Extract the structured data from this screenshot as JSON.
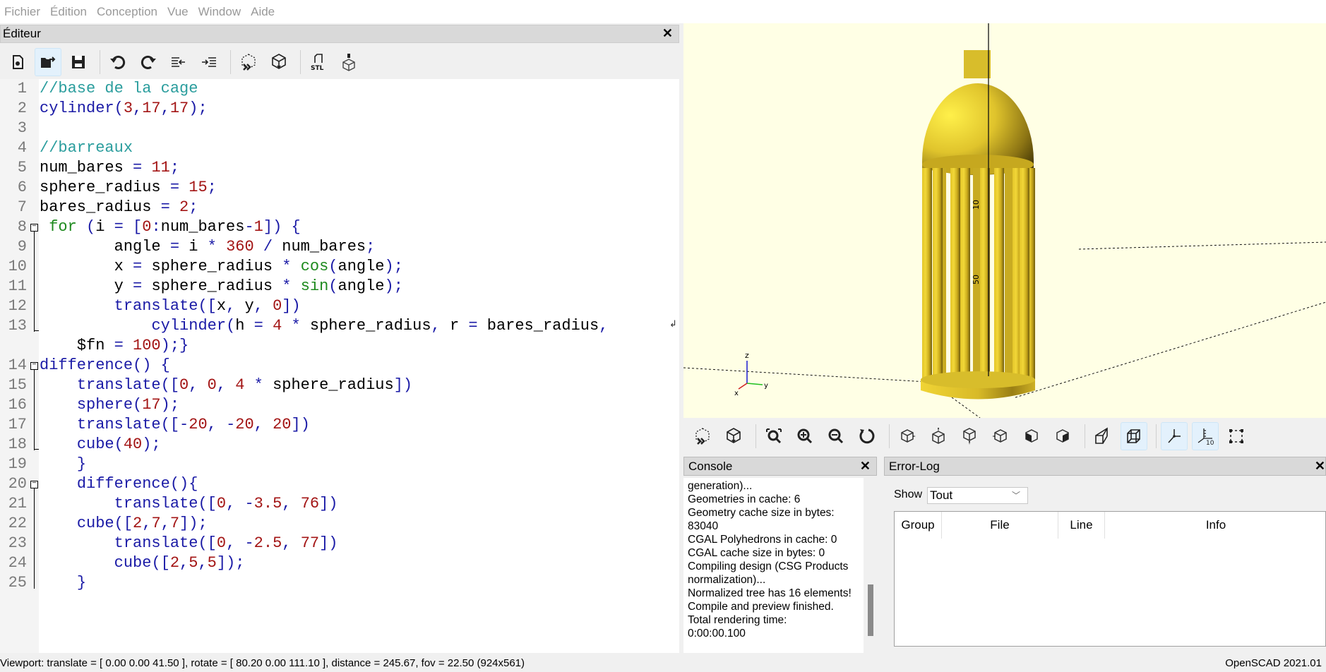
{
  "menubar": {
    "items": [
      "Fichier",
      "Édition",
      "Conception",
      "Vue",
      "Window",
      "Aide"
    ]
  },
  "editor": {
    "title": "Éditeur",
    "close_icon": "close-icon",
    "toolbar": [
      "new-file-icon",
      "open-file-icon",
      "save-icon",
      "undo-icon",
      "redo-icon",
      "unindent-icon",
      "indent-icon",
      "preview-icon",
      "render-icon",
      "export-stl-icon",
      "send-to-printer-icon"
    ],
    "stl_label": "STL",
    "lines": [
      {
        "n": "1",
        "text": "//base de la cage"
      },
      {
        "n": "2",
        "text": "cylinder(3,17,17);"
      },
      {
        "n": "3",
        "text": ""
      },
      {
        "n": "4",
        "text": "//barreaux"
      },
      {
        "n": "5",
        "text": "num_bares = 11;"
      },
      {
        "n": "6",
        "text": "sphere_radius = 15;"
      },
      {
        "n": "7",
        "text": "bares_radius = 2;"
      },
      {
        "n": "8",
        "text": " for (i = [0:num_bares-1]) {"
      },
      {
        "n": "9",
        "text": "        angle = i * 360 / num_bares;"
      },
      {
        "n": "10",
        "text": "        x = sphere_radius * cos(angle);"
      },
      {
        "n": "11",
        "text": "        y = sphere_radius * sin(angle);"
      },
      {
        "n": "12",
        "text": "        translate([x, y, 0])"
      },
      {
        "n": "13",
        "text": "            cylinder(h = 4 * sphere_radius, r = bares_radius,"
      },
      {
        "n": "",
        "text": "    $fn = 100);}"
      },
      {
        "n": "14",
        "text": "difference() {"
      },
      {
        "n": "15",
        "text": "    translate([0, 0, 4 * sphere_radius])"
      },
      {
        "n": "16",
        "text": "    sphere(17);"
      },
      {
        "n": "17",
        "text": "    translate([-20, -20, 20])"
      },
      {
        "n": "18",
        "text": "    cube(40);"
      },
      {
        "n": "19",
        "text": "    }"
      },
      {
        "n": "20",
        "text": "    difference(){"
      },
      {
        "n": "21",
        "text": "        translate([0, -3.5, 76])"
      },
      {
        "n": "22",
        "text": "    cube([2,7,7]);"
      },
      {
        "n": "23",
        "text": "        translate([0, -2.5, 77])"
      },
      {
        "n": "24",
        "text": "        cube([2,5,5]);"
      },
      {
        "n": "25",
        "text": "    }"
      }
    ]
  },
  "viewer": {
    "model_color": "#e8d030",
    "background": "#ffffe5",
    "axis_label_z": "z",
    "axis_label_y": "y",
    "axis_label_x": "x",
    "scale_labels": [
      "10",
      "50"
    ],
    "toolbar": [
      "preview-icon",
      "render-icon",
      "view-all-icon",
      "zoom-in-icon",
      "zoom-out-icon",
      "reset-view-icon",
      "view-right-icon",
      "view-top-icon",
      "view-bottom-icon",
      "view-left-icon",
      "view-front-icon",
      "view-back-icon",
      "perspective-icon",
      "orthogonal-icon",
      "show-axes-icon",
      "show-scale-icon",
      "show-edges-icon"
    ],
    "scale_badge": "10"
  },
  "console": {
    "title": "Console",
    "lines": [
      "generation)...",
      "Geometries in cache: 6",
      "Geometry cache size in bytes:",
      "83040",
      "CGAL Polyhedrons in cache: 0",
      "CGAL cache size in bytes: 0",
      "Compiling design (CSG Products",
      "normalization)...",
      "Normalized tree has 16 elements!",
      "Compile and preview finished.",
      "Total rendering time:",
      "0:00:00.100"
    ]
  },
  "errorlog": {
    "title": "Error-Log",
    "show_label": "Show",
    "show_value": "Tout",
    "columns": [
      "Group",
      "File",
      "Line",
      "Info"
    ]
  },
  "statusbar": {
    "viewport": "Viewport: translate = [ 0.00 0.00 41.50 ], rotate = [ 80.20 0.00 111.10 ], distance = 245.67, fov = 22.50 (924x561)",
    "version": "OpenSCAD 2021.01"
  }
}
